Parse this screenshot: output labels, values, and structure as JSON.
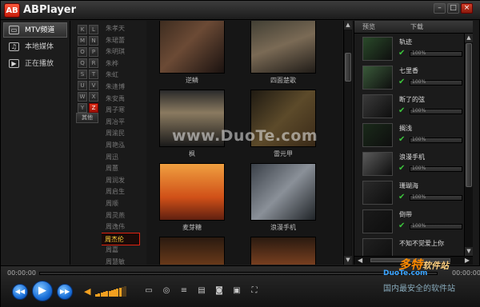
{
  "app": {
    "title": "ABPlayer",
    "logo_text": "AB"
  },
  "window_controls": {
    "minimize": "–",
    "maximize": "□",
    "close": "×"
  },
  "nav": [
    {
      "label": "MTV频道",
      "active": true,
      "icon": "mtv-icon"
    },
    {
      "label": "本地媒体",
      "active": false,
      "icon": "music-note-icon"
    },
    {
      "label": "正在播放",
      "active": false,
      "icon": "play-icon"
    }
  ],
  "letters": [
    "K",
    "L",
    "M",
    "N",
    "O",
    "P",
    "Q",
    "R",
    "S",
    "T",
    "U",
    "V",
    "W",
    "X",
    "Y",
    "Z"
  ],
  "active_letter": "Z",
  "other_label": "其他",
  "singers": [
    "朱孝天",
    "朱珺蕾",
    "朱明琪",
    "朱桦",
    "朱虹",
    "朱逢博",
    "朱安禹",
    "周子寒",
    "周冶平",
    "周渝民",
    "周艳泓",
    "周迅",
    "周蕙",
    "周润发",
    "周启生",
    "周顺",
    "周灵燕",
    "周逸伟",
    "周杰伦",
    "周嘉",
    "周慧敏"
  ],
  "selected_singer": "周杰伦",
  "videos": [
    {
      "title": "逆鳞"
    },
    {
      "title": "四面楚歌"
    },
    {
      "title": "枫"
    },
    {
      "title": "雷元甲"
    },
    {
      "title": "麦芽糖"
    },
    {
      "title": "浪漫手机"
    },
    {
      "title": ""
    },
    {
      "title": ""
    }
  ],
  "watermark": "www.DuoTe.com",
  "download_panel": {
    "header_preview": "预览",
    "header_download": "下载",
    "items": [
      {
        "title": "轨迹",
        "percent": "100%",
        "progress": 1.0
      },
      {
        "title": "七里香",
        "percent": "100%",
        "progress": 1.0
      },
      {
        "title": "断了的弦",
        "percent": "100%",
        "progress": 1.0
      },
      {
        "title": "搁浅",
        "percent": "100%",
        "progress": 1.0
      },
      {
        "title": "浪漫手机",
        "percent": "100%",
        "progress": 1.0
      },
      {
        "title": "珊瑚海",
        "percent": "100%",
        "progress": 1.0
      },
      {
        "title": "倒带",
        "percent": "100%",
        "progress": 1.0
      },
      {
        "title": "不知不觉爱上你",
        "percent": "",
        "progress": 0
      }
    ]
  },
  "player": {
    "time_current": "00:00:00",
    "time_total": "00:00:00",
    "volume": 0.8
  },
  "branding": {
    "logo": "多特",
    "logo_sub": "软件站",
    "url": "DuoTe.com",
    "tagline": "国内最安全的软件站"
  }
}
